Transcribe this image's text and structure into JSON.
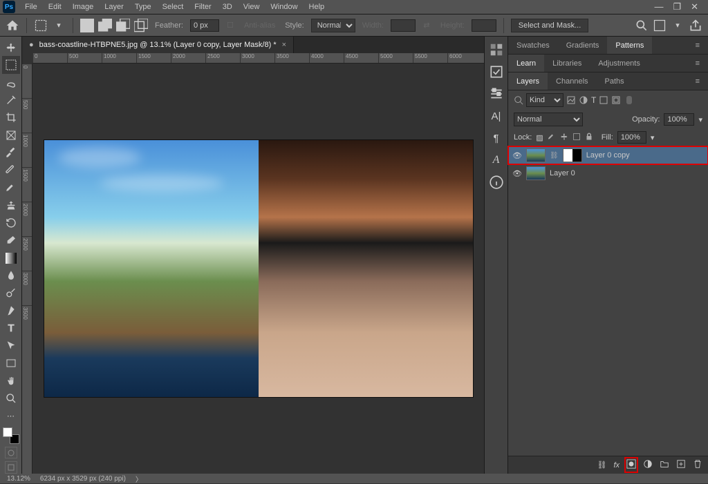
{
  "menu": [
    "File",
    "Edit",
    "Image",
    "Layer",
    "Type",
    "Select",
    "Filter",
    "3D",
    "View",
    "Window",
    "Help"
  ],
  "options": {
    "feather_label": "Feather:",
    "feather_value": "0 px",
    "antialias": "Anti-alias",
    "style_label": "Style:",
    "style_value": "Normal",
    "width_label": "Width:",
    "height_label": "Height:",
    "select_mask": "Select and Mask..."
  },
  "doc": {
    "tab": "bass-coastline-HTBPNE5.jpg @ 13.1% (Layer 0 copy, Layer Mask/8) *",
    "ruler_h": [
      "0",
      "500",
      "1000",
      "1500",
      "2000",
      "2500",
      "3000",
      "3500",
      "4000",
      "4500",
      "5000",
      "5500",
      "6000"
    ],
    "ruler_v": [
      "0",
      "500",
      "1000",
      "1500",
      "2000",
      "2500",
      "3000",
      "3500"
    ]
  },
  "panel_top": {
    "tabs": [
      "Swatches",
      "Gradients",
      "Patterns"
    ],
    "active": 2
  },
  "panel_learn": {
    "tabs": [
      "Learn",
      "Libraries",
      "Adjustments"
    ],
    "active": 0
  },
  "layers_panel": {
    "tabs": [
      "Layers",
      "Channels",
      "Paths"
    ],
    "active": 0,
    "kind_label": "Kind",
    "blend": "Normal",
    "opacity_label": "Opacity:",
    "opacity_value": "100%",
    "lock_label": "Lock:",
    "fill_label": "Fill:",
    "fill_value": "100%",
    "layers": [
      {
        "name": "Layer 0 copy",
        "selected": true,
        "has_mask": true
      },
      {
        "name": "Layer 0",
        "selected": false,
        "has_mask": false
      }
    ]
  },
  "status": {
    "zoom": "13.12%",
    "docinfo": "6234 px x 3529 px (240 ppi)"
  }
}
